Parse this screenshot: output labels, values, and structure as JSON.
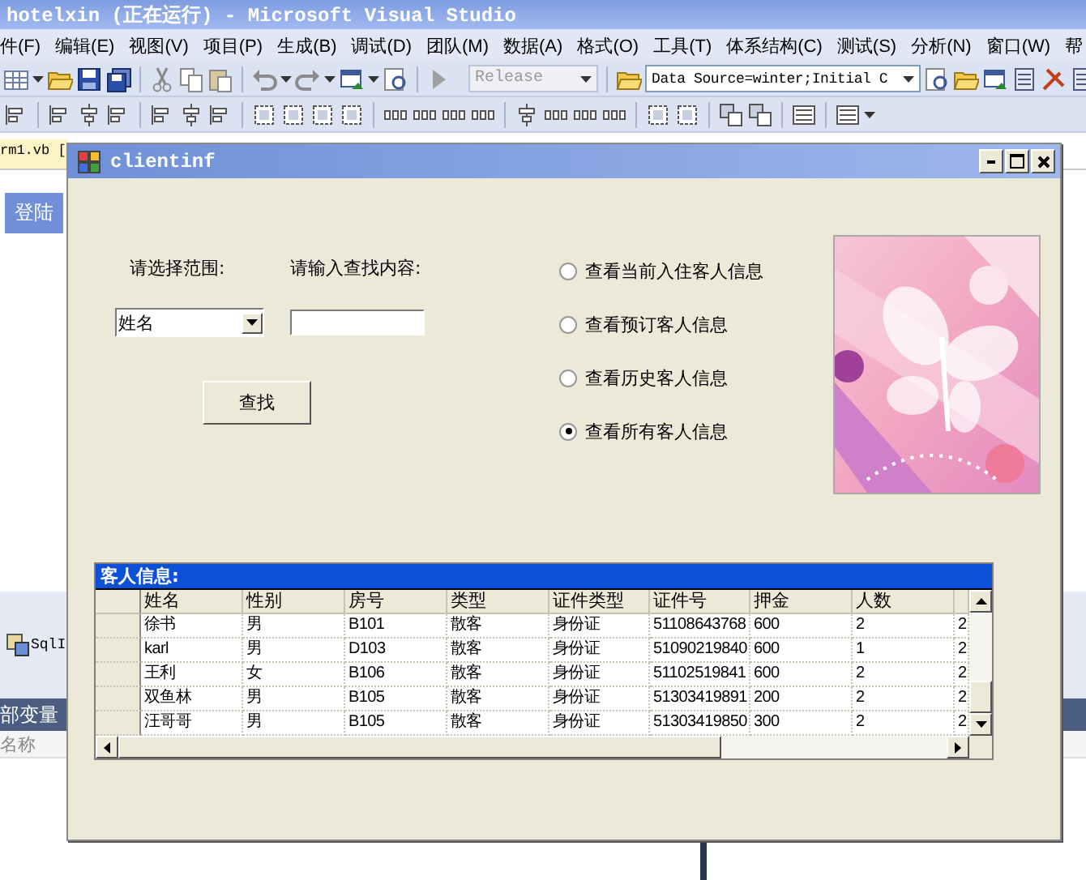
{
  "ide": {
    "title": "hotelxin (正在运行) - Microsoft Visual Studio",
    "menu": [
      "件(F)",
      "编辑(E)",
      "视图(V)",
      "项目(P)",
      "生成(B)",
      "调试(D)",
      "团队(M)",
      "数据(A)",
      "格式(O)",
      "工具(T)",
      "体系结构(C)",
      "测试(S)",
      "分析(N)",
      "窗口(W)",
      "帮"
    ],
    "config_box": {
      "value": "Release",
      "disabled": true
    },
    "connection_box": {
      "value": "Data Source=winter;Initial C",
      "disabled": false
    },
    "document_tab": "rm1.vb [",
    "designer_button": "登陆",
    "component": "SqlI",
    "panel_title": "部变量",
    "panel_column": "名称"
  },
  "dialog": {
    "title": "clientinf",
    "range_label": "请选择范围:",
    "range_value": "姓名",
    "search_label": "请输入查找内容:",
    "search_button": "查找",
    "options": [
      {
        "label": "查看当前入住客人信息",
        "selected": false
      },
      {
        "label": "查看预订客人信息",
        "selected": false
      },
      {
        "label": "查看历史客人信息",
        "selected": false
      },
      {
        "label": "查看所有客人信息",
        "selected": true
      }
    ],
    "grid": {
      "caption": "客人信息:",
      "columns": [
        "姓名",
        "性别",
        "房号",
        "类型",
        "证件类型",
        "证件号",
        "押金",
        "人数"
      ],
      "rows": [
        [
          "徐书",
          "男",
          "B101",
          "散客",
          "身份证",
          "51108643768",
          "600",
          "2",
          "2"
        ],
        [
          "karl",
          "男",
          "D103",
          "散客",
          "身份证",
          "51090219840",
          "600",
          "1",
          "2"
        ],
        [
          "王利",
          "女",
          "B106",
          "散客",
          "身份证",
          "51102519841",
          "600",
          "2",
          "2"
        ],
        [
          "双鱼林",
          "男",
          "B105",
          "散客",
          "身份证",
          "51303419891",
          "200",
          "2",
          "2"
        ],
        [
          "汪哥哥",
          "男",
          "B105",
          "散客",
          "身份证",
          "51303419850",
          "300",
          "2",
          "2"
        ]
      ]
    }
  }
}
